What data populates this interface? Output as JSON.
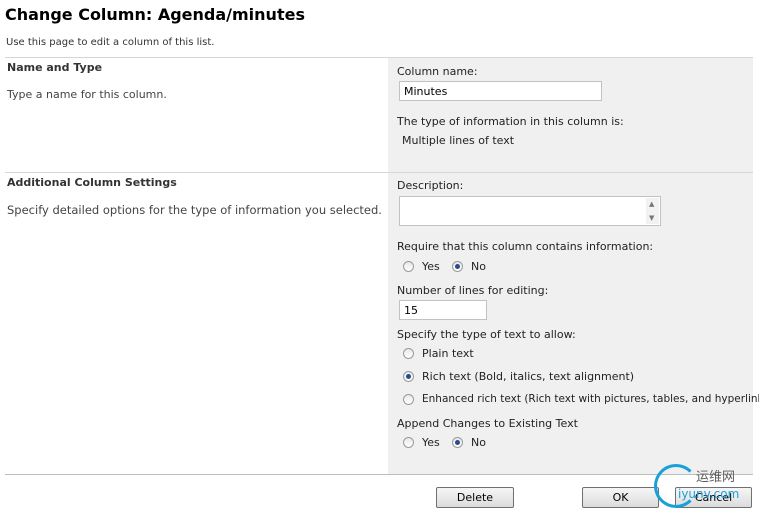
{
  "page": {
    "title": "Change Column: Agenda/minutes",
    "description": "Use this page to edit a column of this list."
  },
  "name_and_type": {
    "title": "Name and Type",
    "description": "Type a name for this column.",
    "column_name_label": "Column name:",
    "column_name_value": "Minutes",
    "type_label": "The type of information in this column is:",
    "type_value": "Multiple lines of text"
  },
  "additional": {
    "title": "Additional Column Settings",
    "description": "Specify detailed options for the type of information you selected.",
    "description_label": "Description:",
    "description_value": "",
    "require_label": "Require that this column contains information:",
    "require_options": [
      {
        "label": "Yes",
        "checked": false
      },
      {
        "label": "No",
        "checked": true
      }
    ],
    "lines_label": "Number of lines for editing:",
    "lines_value": "15",
    "text_type_label": "Specify the type of text to allow:",
    "text_type_options": [
      {
        "label": "Plain text",
        "checked": false
      },
      {
        "label": "Rich text (Bold, italics, text alignment)",
        "checked": true
      },
      {
        "label": "Enhanced rich text (Rich text with pictures, tables, and hyperlinks)",
        "checked": false
      }
    ],
    "append_label": "Append Changes to Existing Text",
    "append_options": [
      {
        "label": "Yes",
        "checked": false
      },
      {
        "label": "No",
        "checked": true
      }
    ]
  },
  "buttons": {
    "delete": "Delete",
    "ok": "OK",
    "cancel": "Cancel"
  },
  "watermark": {
    "cn": "运维网",
    "en": "iyunv.com"
  },
  "colors": {
    "section_right_bg": "#f0f0f0",
    "radio_checked": "#2a4a8a",
    "watermark_blue": "#1aa0d8"
  }
}
